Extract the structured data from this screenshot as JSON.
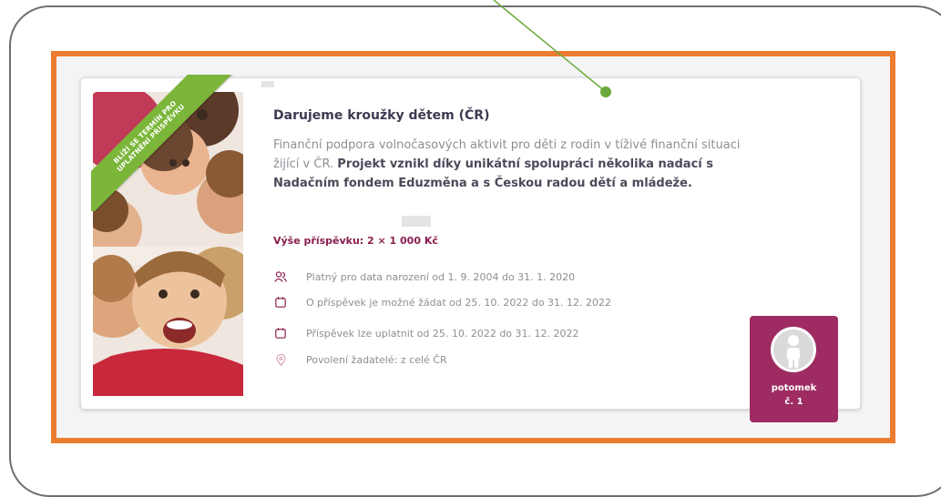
{
  "card": {
    "title": "Darujeme kroužky dětem (ČR)",
    "description_plain": "Finanční podpora volnočasových aktivit pro děti z rodin v tíživé finanční situaci žijící v ČR. ",
    "description_bold": "Projekt vznikl díky unikátní spolupráci několika nadací s Nadačním fondem Eduzměna a s Českou radou dětí a mládeže.",
    "ribbon": [
      "BLÍŽÍ SE TERMÍN PRO",
      "UPLATNĚNÍ PŘÍSPĚVKU"
    ],
    "amount": "Výše příspěvku: 2 × 1 000 Kč",
    "info": [
      {
        "icon": "people-icon",
        "text": "Platný pro data narození od 1. 9. 2004 do 31. 1. 2020"
      },
      {
        "icon": "calendar-icon",
        "text": "O příspěvek je možné žádat od 25. 10. 2022 do 31. 12. 2022"
      },
      {
        "icon": "calendar-icon",
        "text": "Příspěvek lze uplatnit od 25. 10. 2022 do 31. 12. 2022"
      },
      {
        "icon": "location-pin-icon",
        "text": "Povolení žadatelé: z celé ČR"
      }
    ],
    "badge": {
      "line1": "potomek",
      "line2": "č. 1"
    }
  },
  "colors": {
    "highlight": "#ec7c30",
    "ribbon": "#7bb63a",
    "accent": "#9e2c63",
    "amount": "#8a1f4e",
    "pointer": "#6aaa3a"
  }
}
